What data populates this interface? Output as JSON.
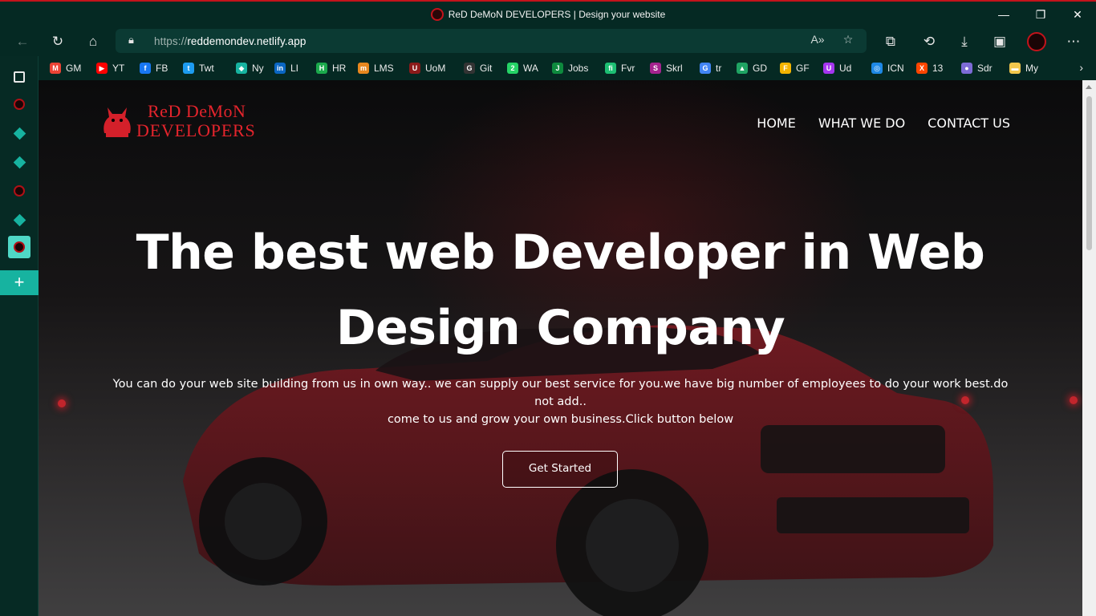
{
  "window": {
    "title": "ReD DeMoN DEVELOPERS | Design your website",
    "controls": {
      "minimize": "—",
      "maximize": "❐",
      "close": "✕"
    }
  },
  "toolbar": {
    "url_protocol": "https://",
    "url_host": "reddemondev.netlify.app",
    "icons": [
      "back-icon",
      "refresh-icon",
      "home-icon",
      "lock-icon",
      "read-aloud-icon",
      "favorite-add-icon",
      "extensions-icon",
      "history-icon",
      "downloads-icon",
      "collections-icon",
      "profile-avatar",
      "more-icon"
    ]
  },
  "bookmarks": [
    {
      "label": "GM",
      "color": "#ea4335",
      "glyph": "M"
    },
    {
      "label": "YT",
      "color": "#ff0000",
      "glyph": "▶"
    },
    {
      "label": "FB",
      "color": "#1877f2",
      "glyph": "f"
    },
    {
      "label": "Twt",
      "color": "#1d9bf0",
      "glyph": "t"
    },
    {
      "label": "Ny",
      "color": "#17b3a0",
      "glyph": "◆"
    },
    {
      "label": "LI",
      "color": "#0a66c2",
      "glyph": "in"
    },
    {
      "label": "HR",
      "color": "#1ba94c",
      "glyph": "H"
    },
    {
      "label": "LMS",
      "color": "#e8871e",
      "glyph": "m"
    },
    {
      "label": "UoM",
      "color": "#8b1a1a",
      "glyph": "U"
    },
    {
      "label": "Git",
      "color": "#333333",
      "glyph": "G"
    },
    {
      "label": "WA",
      "color": "#25d366",
      "glyph": "2"
    },
    {
      "label": "Jobs",
      "color": "#0e8a3e",
      "glyph": "J"
    },
    {
      "label": "Fvr",
      "color": "#1dbf73",
      "glyph": "fi"
    },
    {
      "label": "Skrl",
      "color": "#a4238e",
      "glyph": "S"
    },
    {
      "label": "tr",
      "color": "#4285f4",
      "glyph": "G"
    },
    {
      "label": "GD",
      "color": "#1fa463",
      "glyph": "▲"
    },
    {
      "label": "GF",
      "color": "#f4b400",
      "glyph": "F"
    },
    {
      "label": "Ud",
      "color": "#a435f0",
      "glyph": "U"
    },
    {
      "label": "ICN",
      "color": "#1e88e5",
      "glyph": "◎"
    },
    {
      "label": "13",
      "color": "#ff4500",
      "glyph": "X"
    },
    {
      "label": "Sdr",
      "color": "#7d6bd6",
      "glyph": "●"
    },
    {
      "label": "My",
      "color": "#f3c74c",
      "glyph": "▬"
    }
  ],
  "vertical_tabs": [
    "tab-actions-icon",
    "tab-reddemon",
    "tab-ny-1",
    "tab-ny-2",
    "tab-reddemon-2",
    "tab-ny-3",
    "tab-reddemon-active"
  ],
  "site": {
    "logo_line1": "ReD DeMoN",
    "logo_line2": "DEVELOPERS",
    "nav": [
      "HOME",
      "WHAT WE DO",
      "CONTACT US"
    ],
    "hero_title_line1": "The best web Developer in Web",
    "hero_title_line2": "Design Company",
    "hero_sub_line1": "You can do your web site building from us in own way.. we can supply our best service for you.we have big number of employees to do your work best.do not add..",
    "hero_sub_line2": "come to us and grow your own business.Click button below",
    "cta": "Get Started"
  },
  "colors": {
    "accent_teal": "#17b3a0",
    "brand_red": "#e4242c",
    "chrome_bg": "#052923"
  }
}
